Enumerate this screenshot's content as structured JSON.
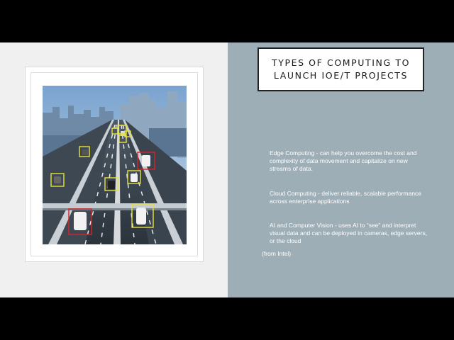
{
  "slide": {
    "title": "TYPES OF COMPUTING TO\nLAUNCH IOE/T PROJECTS",
    "bullets": [
      "Edge Computing - can help you overcome the cost and complexity of data movement and capitalize on new streams of data.",
      "Cloud Computing - deliver reliable, scalable performance across enterprise applications",
      "AI and Computer Vision - uses AI to “see” and interpret visual data and can be deployed in cameras, edge servers, or the cloud"
    ],
    "source": "(from Intel)"
  },
  "image": {
    "subject": "highway-traffic-detection-photo"
  },
  "colors": {
    "right_panel": "#9daeb6",
    "left_panel": "#f0f0f0",
    "detection_yellow": "#e8e23a",
    "detection_red": "#d8232a"
  }
}
